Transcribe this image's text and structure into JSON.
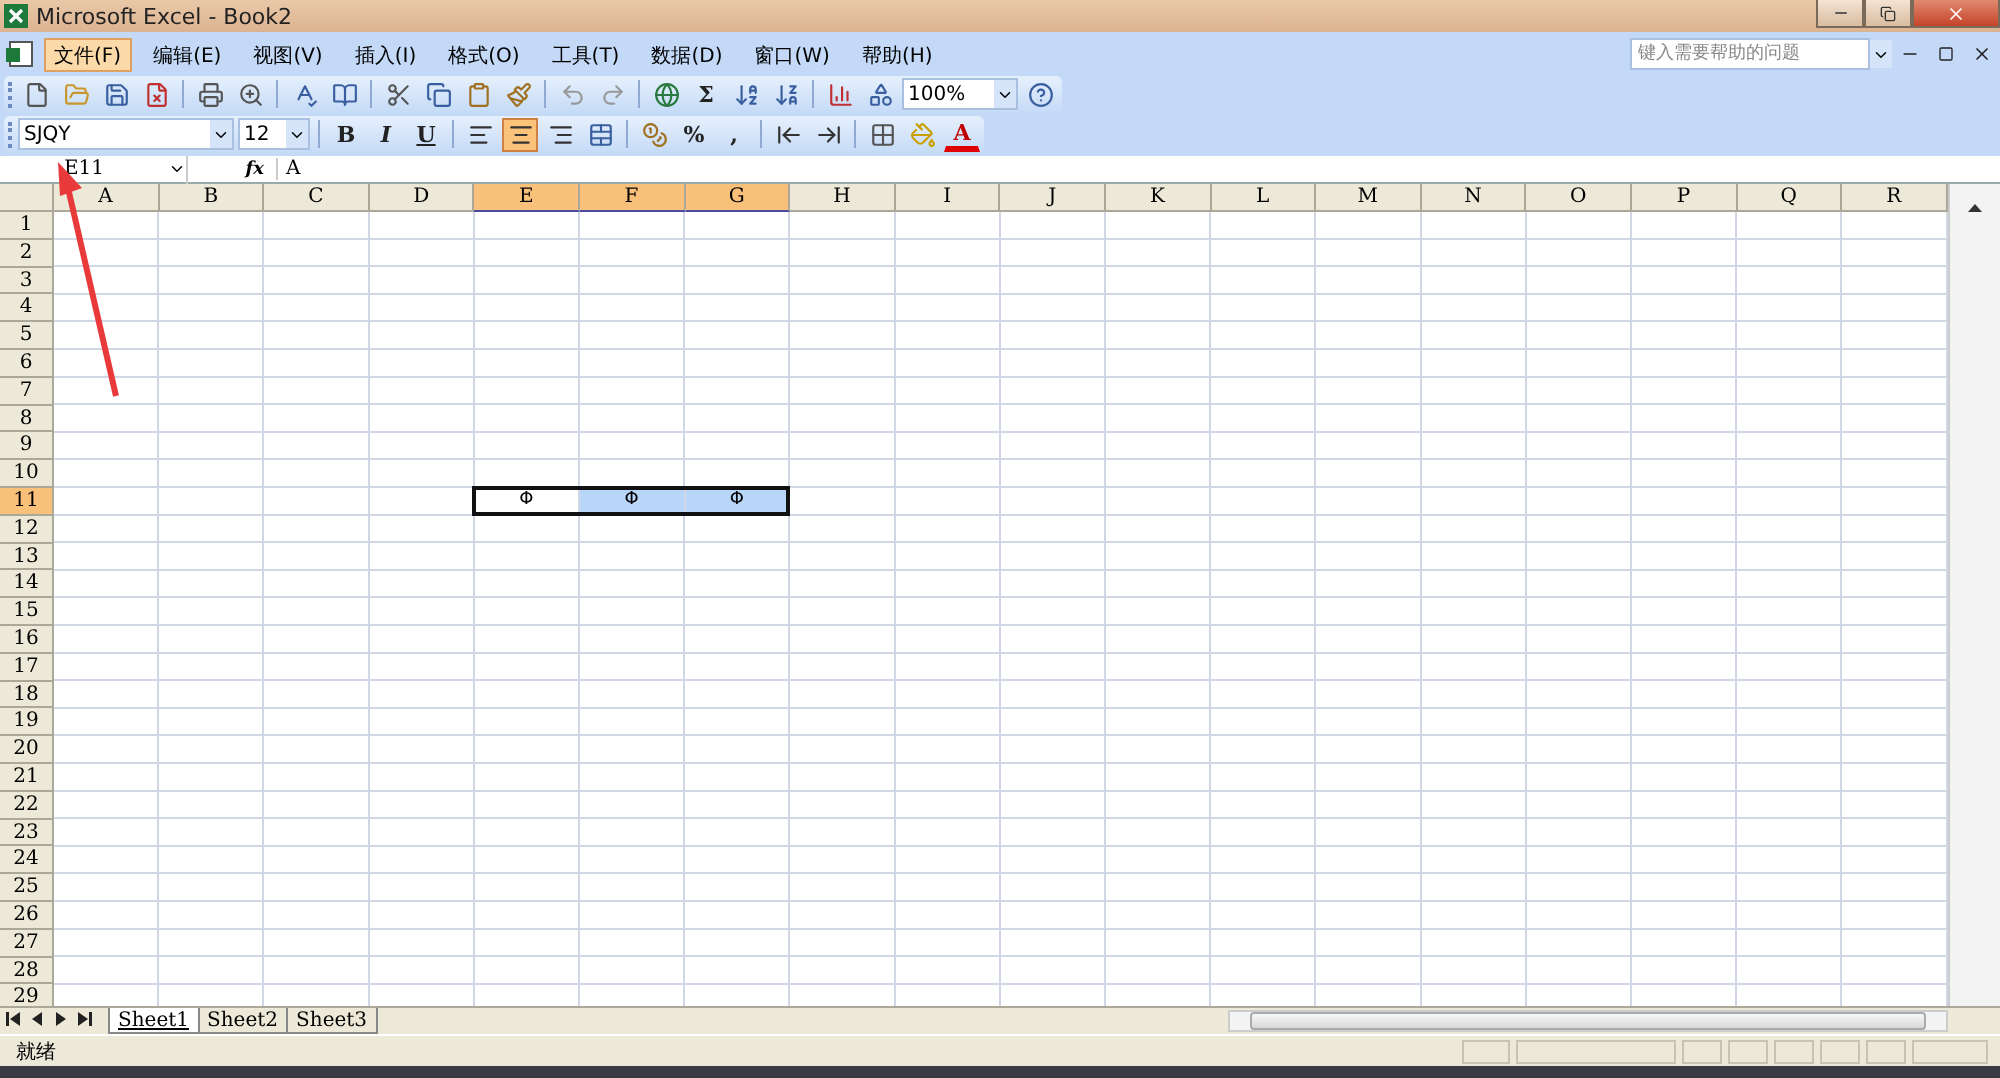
{
  "window": {
    "title": "Microsoft Excel - Book2"
  },
  "menu": [
    {
      "label": "文件(F)",
      "selected": true
    },
    {
      "label": "编辑(E)",
      "selected": false
    },
    {
      "label": "视图(V)",
      "selected": false
    },
    {
      "label": "插入(I)",
      "selected": false
    },
    {
      "label": "格式(O)",
      "selected": false
    },
    {
      "label": "工具(T)",
      "selected": false
    },
    {
      "label": "数据(D)",
      "selected": false
    },
    {
      "label": "窗口(W)",
      "selected": false
    },
    {
      "label": "帮助(H)",
      "selected": false
    }
  ],
  "help_search": {
    "placeholder": "键入需要帮助的问题"
  },
  "standard_toolbar": {
    "sum": "Σ",
    "zoom": "100%"
  },
  "formatting_toolbar": {
    "font": "SJQY",
    "size": "12",
    "styles": [
      {
        "kind": "bold",
        "label": "B",
        "selected": false
      },
      {
        "kind": "italic",
        "label": "I",
        "selected": false
      },
      {
        "kind": "underline",
        "label": "U",
        "selected": false
      }
    ],
    "alignments": [
      {
        "kind": "left",
        "selected": false
      },
      {
        "kind": "center",
        "selected": true
      },
      {
        "kind": "right",
        "selected": false
      }
    ],
    "percent": "%",
    "comma": ",",
    "font_color": "A"
  },
  "formula_bar": {
    "name_box": "E11",
    "function_label": "fx",
    "value": "A"
  },
  "sheet": {
    "columns": [
      {
        "label": "A",
        "selected": false
      },
      {
        "label": "B",
        "selected": false
      },
      {
        "label": "C",
        "selected": false
      },
      {
        "label": "D",
        "selected": false
      },
      {
        "label": "E",
        "selected": true
      },
      {
        "label": "F",
        "selected": true
      },
      {
        "label": "G",
        "selected": true
      },
      {
        "label": "H",
        "selected": false
      },
      {
        "label": "I",
        "selected": false
      },
      {
        "label": "J",
        "selected": false
      },
      {
        "label": "K",
        "selected": false
      },
      {
        "label": "L",
        "selected": false
      },
      {
        "label": "M",
        "selected": false
      },
      {
        "label": "N",
        "selected": false
      },
      {
        "label": "O",
        "selected": false
      },
      {
        "label": "P",
        "selected": false
      },
      {
        "label": "Q",
        "selected": false
      },
      {
        "label": "R",
        "selected": false
      }
    ],
    "rows": [
      {
        "label": "1",
        "selected": false
      },
      {
        "label": "2",
        "selected": false
      },
      {
        "label": "3",
        "selected": false
      },
      {
        "label": "4",
        "selected": false
      },
      {
        "label": "5",
        "selected": false
      },
      {
        "label": "6",
        "selected": false
      },
      {
        "label": "7",
        "selected": false
      },
      {
        "label": "8",
        "selected": false
      },
      {
        "label": "9",
        "selected": false
      },
      {
        "label": "10",
        "selected": false
      },
      {
        "label": "11",
        "selected": true,
        "cells": [
          {
            "value": "Φ",
            "active": true
          },
          {
            "value": "Φ",
            "active": false
          },
          {
            "value": "Φ",
            "active": false
          }
        ]
      },
      {
        "label": "12",
        "selected": false
      },
      {
        "label": "13",
        "selected": false
      },
      {
        "label": "14",
        "selected": false
      },
      {
        "label": "15",
        "selected": false
      },
      {
        "label": "16",
        "selected": false
      },
      {
        "label": "17",
        "selected": false
      },
      {
        "label": "18",
        "selected": false
      },
      {
        "label": "19",
        "selected": false
      },
      {
        "label": "20",
        "selected": false
      },
      {
        "label": "21",
        "selected": false
      },
      {
        "label": "22",
        "selected": false
      },
      {
        "label": "23",
        "selected": false
      },
      {
        "label": "24",
        "selected": false
      },
      {
        "label": "25",
        "selected": false
      },
      {
        "label": "26",
        "selected": false
      },
      {
        "label": "27",
        "selected": false
      },
      {
        "label": "28",
        "selected": false
      },
      {
        "label": "29",
        "selected": false
      }
    ]
  },
  "sheet_tabs": [
    {
      "label": "Sheet1",
      "selected": true
    },
    {
      "label": "Sheet2",
      "selected": false
    },
    {
      "label": "Sheet3",
      "selected": false
    }
  ],
  "status_bar": {
    "text": "就绪"
  }
}
